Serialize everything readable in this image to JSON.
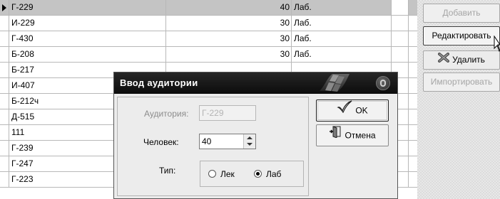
{
  "grid": {
    "rows": [
      {
        "name": "Г-229",
        "count": "40",
        "type": "Лаб.",
        "selected": true
      },
      {
        "name": "И-229",
        "count": "30",
        "type": "Лаб."
      },
      {
        "name": "Г-430",
        "count": "30",
        "type": "Лаб."
      },
      {
        "name": "Б-208",
        "count": "30",
        "type": "Лаб."
      },
      {
        "name": "Б-217",
        "count": "",
        "type": ""
      },
      {
        "name": "И-407",
        "count": "",
        "type": ""
      },
      {
        "name": "Б-212ч",
        "count": "",
        "type": ""
      },
      {
        "name": "Д-515",
        "count": "",
        "type": ""
      },
      {
        "name": "111",
        "count": "",
        "type": ""
      },
      {
        "name": "Г-239",
        "count": "",
        "type": ""
      },
      {
        "name": "Г-247",
        "count": "",
        "type": ""
      },
      {
        "name": "Г-223",
        "count": "",
        "type": ""
      }
    ]
  },
  "panel": {
    "add_label": "Добавить",
    "edit_label": "Редактировать",
    "delete_label": "Удалить",
    "import_label": "Импортировать"
  },
  "dialog": {
    "title": "Ввод аудитории",
    "room_label": "Аудитория:",
    "room_value": "Г-229",
    "people_label": "Человек:",
    "people_value": "40",
    "type_label": "Тип:",
    "radio_lec": "Лек",
    "radio_lab": "Лаб",
    "selected_type": "Лаб",
    "ok_label": "OK",
    "cancel_label": "Отмена"
  }
}
